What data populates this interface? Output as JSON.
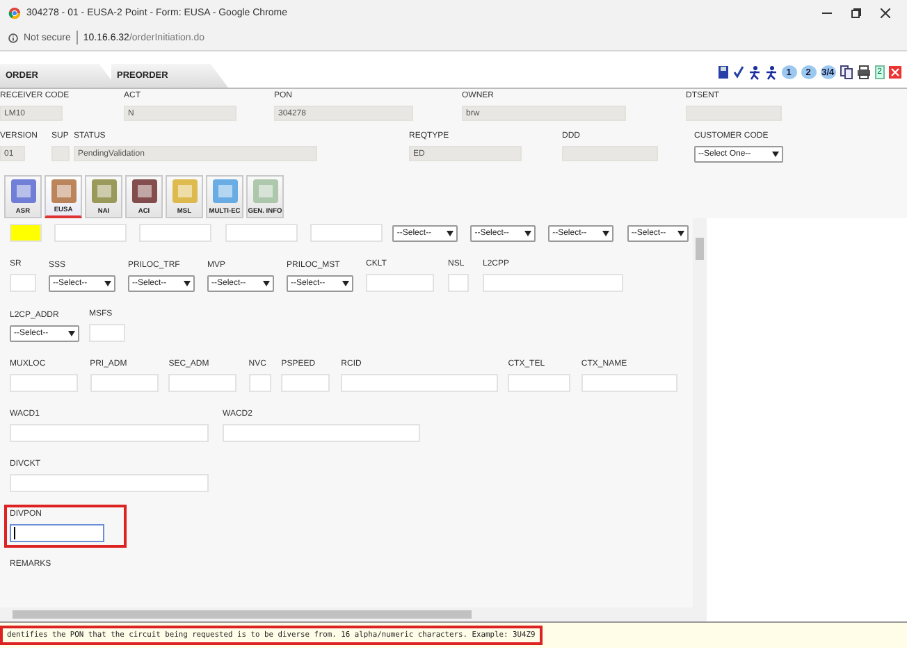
{
  "window": {
    "title": "304278 - 01 - EUSA-2 Point - Form: EUSA - Google Chrome"
  },
  "address_bar": {
    "security": "Not secure",
    "host": "10.16.6.32",
    "path": "/orderInitiation.do"
  },
  "tabs": [
    {
      "label": "ORDER",
      "selected": false
    },
    {
      "label": "PREORDER",
      "selected": false
    }
  ],
  "toolbar": [
    {
      "kind": "save"
    },
    {
      "kind": "check"
    },
    {
      "kind": "figure"
    },
    {
      "kind": "figure"
    },
    {
      "kind": "page",
      "label": "1"
    },
    {
      "kind": "page",
      "label": "2"
    },
    {
      "kind": "page",
      "label": "3/4"
    },
    {
      "kind": "copy"
    },
    {
      "kind": "print"
    },
    {
      "kind": "badge",
      "label": "2"
    },
    {
      "kind": "close"
    }
  ],
  "header": {
    "top_fields": [
      {
        "label": "RECEIVER CODE",
        "kind": "text",
        "value": "LM10"
      },
      {
        "label": "ACT",
        "kind": "text",
        "value": "N"
      },
      {
        "label": "PON",
        "kind": "text",
        "value": "304278"
      },
      {
        "label": "OWNER",
        "kind": "text",
        "value": "brw"
      },
      {
        "label": "DTSENT",
        "kind": "text"
      }
    ],
    "bottom_fields": [
      {
        "label": "VERSION",
        "kind": "text",
        "value": "01"
      },
      {
        "label": "SUP",
        "kind": "text"
      },
      {
        "label": "STATUS",
        "kind": "text",
        "value": "PendingValidation"
      },
      {
        "label": "REQTYPE",
        "kind": "text",
        "value": "ED"
      },
      {
        "label": "DDD",
        "kind": "text"
      },
      {
        "label": "CUSTOMER CODE",
        "kind": "select",
        "value": "--Select One--"
      }
    ]
  },
  "modules": [
    {
      "label": "ASR",
      "selected": false
    },
    {
      "label": "EUSA",
      "selected": true
    },
    {
      "label": "NAI",
      "selected": false
    },
    {
      "label": "ACI",
      "selected": false
    },
    {
      "label": "MSL",
      "selected": false
    },
    {
      "label": "MULTI-EC",
      "selected": false
    },
    {
      "label": "GEN. INFO",
      "selected": false
    }
  ],
  "form": {
    "rows": [
      {
        "fields": [
          {
            "kind": "text",
            "color": "#ffff00"
          },
          {
            "kind": "text"
          },
          {
            "kind": "text"
          },
          {
            "kind": "text"
          },
          {
            "kind": "text"
          },
          {
            "kind": "select",
            "value": "--Select--"
          },
          {
            "kind": "select",
            "value": "--Select--"
          },
          {
            "kind": "select",
            "value": "--Select--"
          },
          {
            "kind": "select",
            "value": "--Select--"
          }
        ]
      },
      {
        "fields": [
          {
            "label": "SR",
            "kind": "text"
          },
          {
            "label": "SSS",
            "kind": "select",
            "value": "--Select--"
          },
          {
            "label": "PRILOC_TRF",
            "kind": "select",
            "value": "--Select--"
          },
          {
            "label": "MVP",
            "kind": "select",
            "value": "--Select--"
          },
          {
            "label": "PRILOC_MST",
            "kind": "select",
            "value": "--Select--"
          },
          {
            "label": "CKLT",
            "kind": "text"
          },
          {
            "label": "NSL",
            "kind": "text"
          },
          {
            "label": "L2CPP",
            "kind": "text"
          }
        ]
      },
      {
        "fields": [
          {
            "label": "L2CP_ADDR",
            "kind": "select",
            "value": "--Select--"
          },
          {
            "label": "MSFS",
            "kind": "text"
          }
        ]
      },
      {
        "fields": [
          {
            "label": "MUXLOC",
            "kind": "text"
          },
          {
            "label": "PRI_ADM",
            "kind": "text"
          },
          {
            "label": "SEC_ADM",
            "kind": "text"
          },
          {
            "label": "NVC",
            "kind": "text"
          },
          {
            "label": "PSPEED",
            "kind": "text"
          },
          {
            "label": "RCID",
            "kind": "text"
          },
          {
            "label": "CTX_TEL",
            "kind": "text"
          },
          {
            "label": "CTX_NAME",
            "kind": "text"
          }
        ]
      },
      {
        "fields": [
          {
            "label": "WACD1",
            "kind": "text"
          },
          {
            "label": "WACD2",
            "kind": "text"
          }
        ]
      },
      {
        "fields": [
          {
            "label": "DIVCKT",
            "kind": "text"
          }
        ]
      },
      {
        "fields": [
          {
            "label": "DIVPON",
            "kind": "text",
            "focused": true,
            "highlighted": true
          }
        ]
      },
      {
        "fields": [
          {
            "label": "REMARKS",
            "kind": "label"
          }
        ]
      }
    ]
  },
  "status_hint": {
    "text": "dentifies the PON that the circuit being requested is to be diverse from. 16 alpha/numeric characters. Example: 3U4Z9",
    "highlighted": true
  }
}
